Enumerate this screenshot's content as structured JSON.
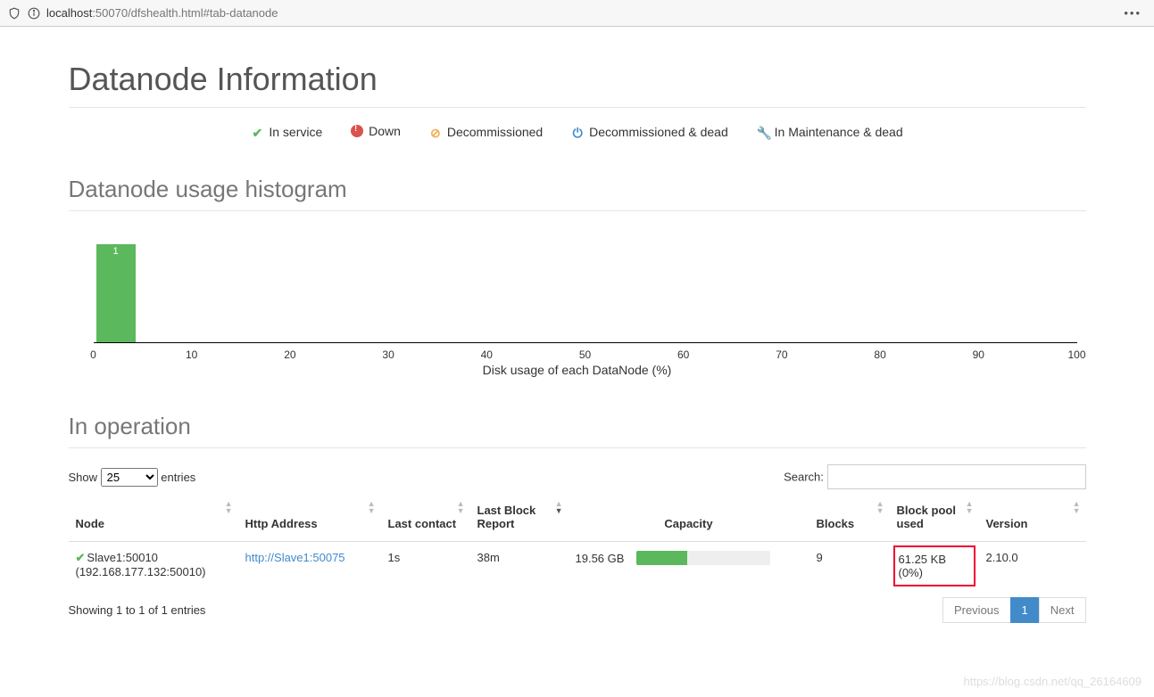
{
  "browser": {
    "url_host": "localhost",
    "url_port_path": ":50070/dfshealth.html#tab-datanode",
    "menu_dots": "•••"
  },
  "page": {
    "title": "Datanode Information"
  },
  "legend": {
    "in_service": "In service",
    "down": "Down",
    "decommissioned": "Decommissioned",
    "decom_dead": "Decommissioned & dead",
    "maint_dead": "In Maintenance & dead"
  },
  "histogram_section_title": "Datanode usage histogram",
  "chart_data": {
    "type": "bar",
    "title": "",
    "xlabel": "Disk usage of each DataNode (%)",
    "ylabel": "",
    "x_ticks": [
      "0",
      "10",
      "20",
      "30",
      "40",
      "50",
      "60",
      "70",
      "80",
      "90",
      "100"
    ],
    "categories": [
      "0-5"
    ],
    "values": [
      1
    ],
    "ylim": [
      0,
      1
    ]
  },
  "operation_section_title": "In operation",
  "datatable": {
    "length_label_pre": "Show",
    "length_label_post": "entries",
    "length_value": "25",
    "search_label": "Search:",
    "search_value": "",
    "columns": {
      "node": "Node",
      "http": "Http Address",
      "last_contact": "Last contact",
      "last_block": "Last Block Report",
      "capacity": "Capacity",
      "blocks": "Blocks",
      "bpu": "Block pool used",
      "version": "Version"
    },
    "rows": [
      {
        "node_name": "Slave1:50010",
        "node_sub": "(192.168.177.132:50010)",
        "http": "http://Slave1:50075",
        "last_contact": "1s",
        "last_block": "38m",
        "capacity_text": "19.56 GB",
        "capacity_pct": 38,
        "blocks": "9",
        "bpu_line1": "61.25 KB",
        "bpu_line2": "(0%)",
        "version": "2.10.0"
      }
    ],
    "info": "Showing 1 to 1 of 1 entries",
    "pager": {
      "prev": "Previous",
      "page1": "1",
      "next": "Next"
    }
  },
  "watermark": "https://blog.csdn.net/qq_26164609"
}
